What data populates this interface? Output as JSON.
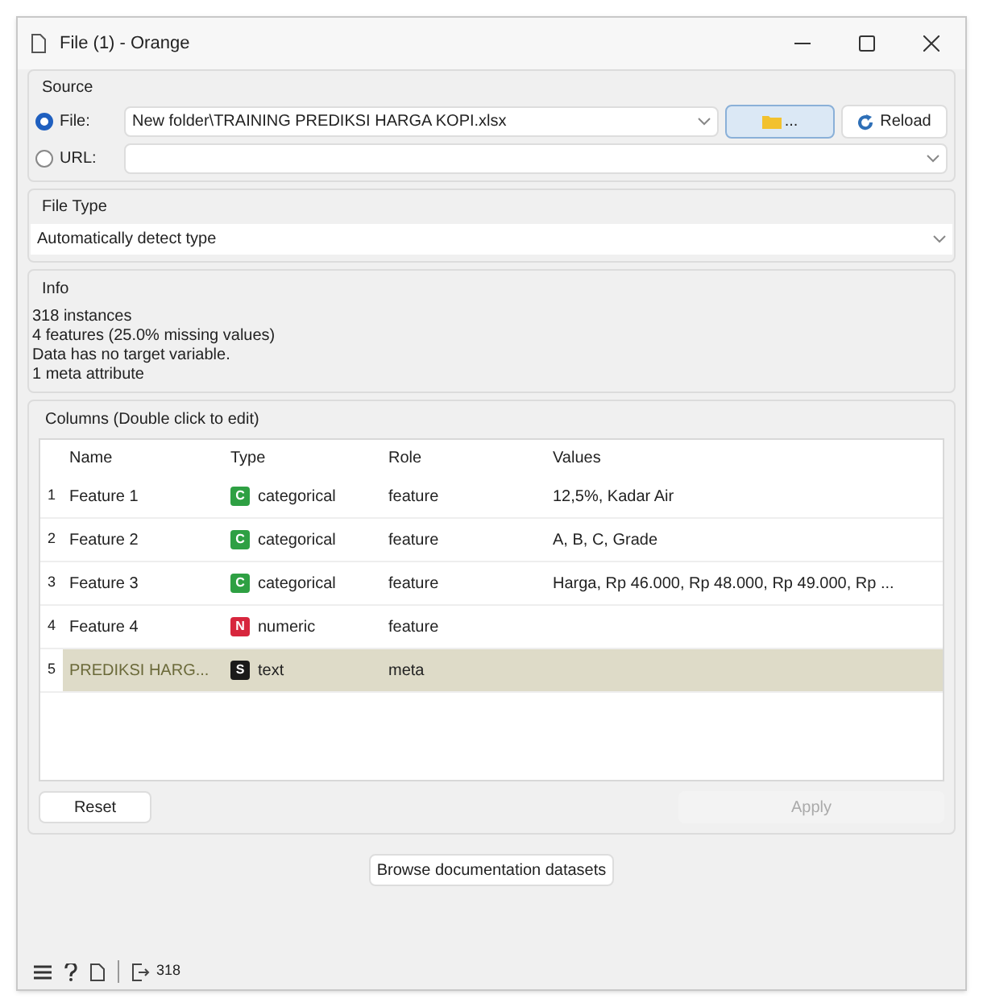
{
  "window": {
    "title": "File (1) - Orange"
  },
  "source": {
    "label": "Source",
    "options": [
      {
        "label": "File:",
        "selected": true,
        "kind": "file",
        "value": "New folder\\TRAINING PREDIKSI HARGA KOPI.xlsx",
        "browse_label": "...",
        "buttons": [
          "Reload"
        ]
      },
      {
        "label": "URL:",
        "selected": false,
        "kind": "url"
      }
    ]
  },
  "file_type": {
    "label": "File Type",
    "value": "Automatically detect type"
  },
  "info": {
    "label": "Info",
    "lines": [
      "318 instances",
      "4 features (25.0% missing values)",
      "Data has no target variable.",
      "1 meta attribute"
    ]
  },
  "columns": {
    "label": "Columns (Double click to edit)",
    "headers": [
      "Name",
      "Type",
      "Role",
      "Values"
    ],
    "rows": [
      {
        "index": "1",
        "name": "Feature 1",
        "badge": "C",
        "color": "#2ea043",
        "type": "categorical",
        "role": "feature",
        "values": "12,5%, Kadar Air",
        "selected": false
      },
      {
        "index": "2",
        "name": "Feature 2",
        "badge": "C",
        "color": "#2ea043",
        "type": "categorical",
        "role": "feature",
        "values": "A, B, C, Grade",
        "selected": false
      },
      {
        "index": "3",
        "name": "Feature 3",
        "badge": "C",
        "color": "#2ea043",
        "type": "categorical",
        "role": "feature",
        "values": "Harga, Rp 46.000, Rp 48.000, Rp 49.000, Rp ...",
        "selected": false
      },
      {
        "index": "4",
        "name": "Feature 4",
        "badge": "N",
        "color": "#d7263d",
        "type": "numeric",
        "role": "feature",
        "selected": false
      },
      {
        "index": "5",
        "name": "PREDIKSI HARG...",
        "badge": "S",
        "color": "#1a1a1a",
        "type": "text",
        "role": "meta",
        "selected": true
      }
    ]
  },
  "buttons": [
    {
      "label": "Reset",
      "disabled": false
    },
    {
      "label": "Apply",
      "disabled": true
    }
  ],
  "browse": {
    "label": "Browse documentation datasets"
  },
  "status_bar": {
    "output_count": "318"
  }
}
